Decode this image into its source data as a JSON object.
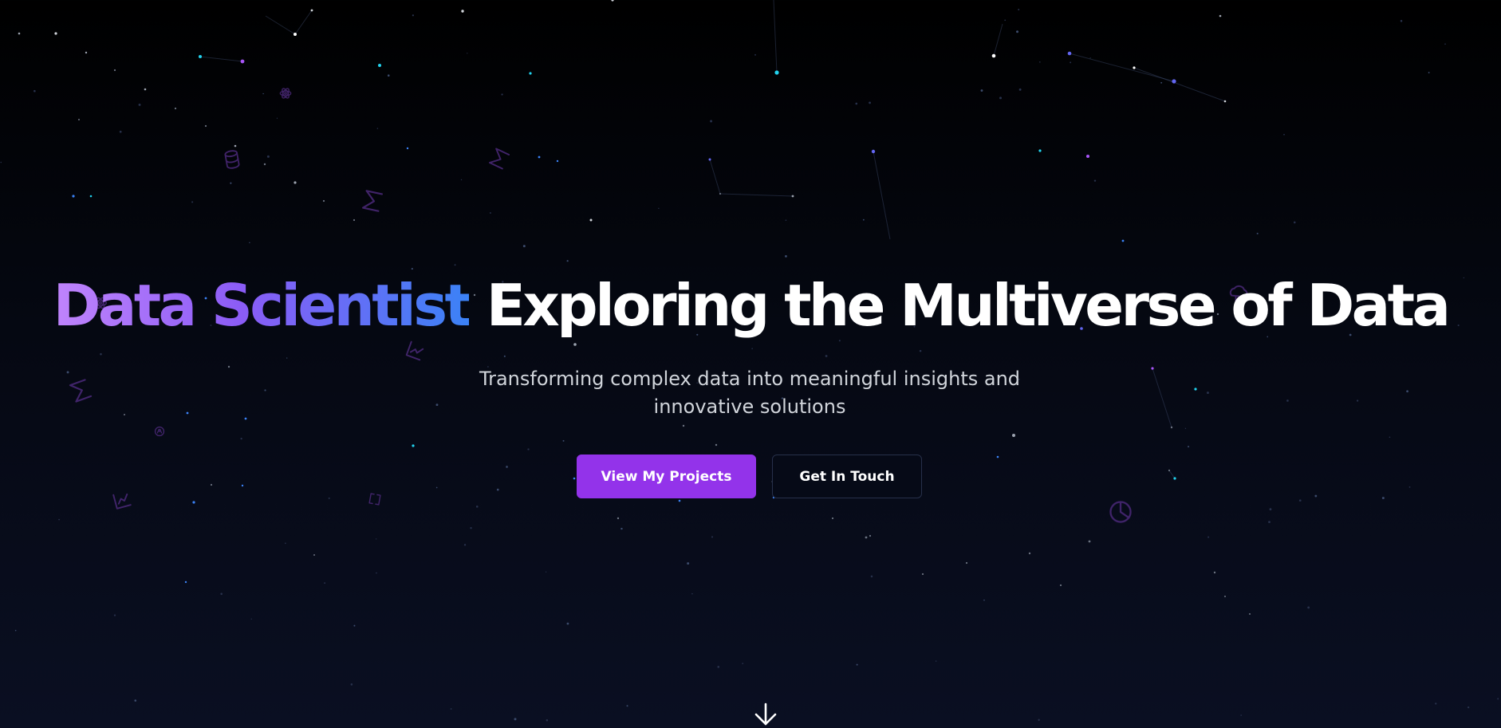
{
  "hero": {
    "title_highlight": "Data Scientist",
    "title_rest": " Exploring the Multiverse of Data",
    "subtitle": "Transforming complex data into meaningful insights and innovative solutions"
  },
  "buttons": {
    "primary_label": "View My Projects",
    "secondary_label": "Get In Touch"
  },
  "icons": {
    "scroll": "arrow-down-icon",
    "floating": [
      "atom-icon",
      "database-icon",
      "sigma-icon",
      "chart-icon",
      "brain-icon",
      "cloud-icon",
      "pie-chart-icon"
    ]
  },
  "colors": {
    "background_top": "#000000",
    "background_bottom": "#0a0f22",
    "gradient_start": "#c084fc",
    "gradient_end": "#3b82f6",
    "primary_button": "#9333ea",
    "secondary_button_border": "#27304a",
    "subtitle_text": "#d1d5db"
  }
}
